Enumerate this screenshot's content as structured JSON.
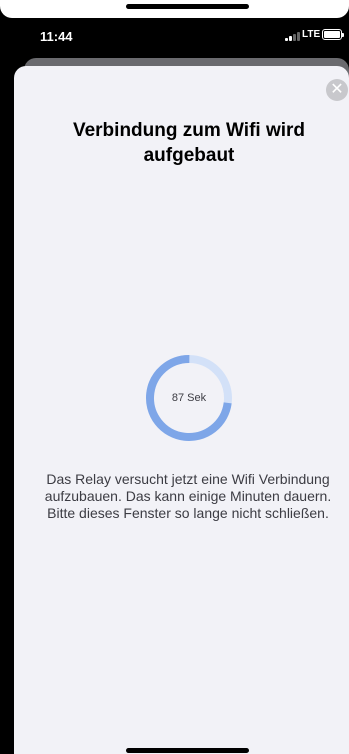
{
  "status_bar": {
    "time": "11:44",
    "network": "LTE"
  },
  "dialog": {
    "title": "Verbindung zum Wifi wird aufgebaut",
    "countdown_label": "87 Sek",
    "progress_fraction": 0.73,
    "description": "Das Relay versucht jetzt eine Wifi Verbindung aufzubauen. Das kann einige Minuten dauern. Bitte dieses Fenster so lange nicht schließen.",
    "close_icon": "close-icon"
  },
  "colors": {
    "progress": "#7ea6e8",
    "progress_track": "#d3e1f8",
    "sheet_bg": "#f2f2f7"
  }
}
